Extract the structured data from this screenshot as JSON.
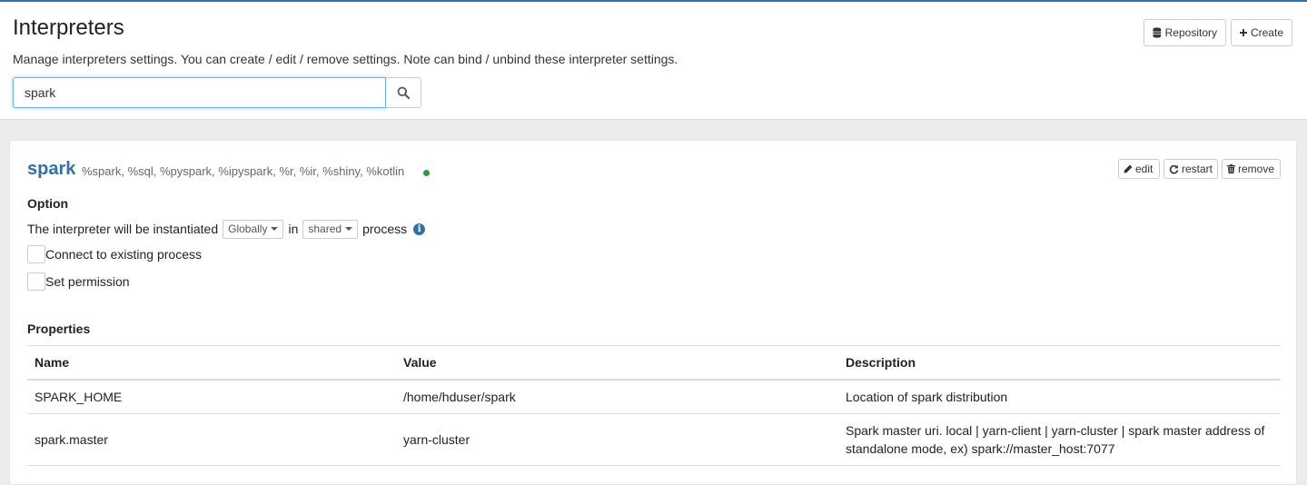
{
  "header": {
    "title": "Interpreters",
    "description": "Manage interpreters settings. You can create / edit / remove settings. Note can bind / unbind these interpreter settings.",
    "repository_label": "Repository",
    "create_label": "Create"
  },
  "search": {
    "value": "spark",
    "icon": "search-icon"
  },
  "interpreter": {
    "name": "spark",
    "aliases": "%spark, %sql, %pyspark, %ipyspark, %r, %ir, %shiny, %kotlin",
    "status_color": "#1f9e3a",
    "edit_label": "edit",
    "restart_label": "restart",
    "remove_label": "remove",
    "option": {
      "heading": "Option",
      "instantiated_text": "The interpreter will be instantiated",
      "scope_value": "Globally",
      "in_text": "in",
      "mode_value": "shared",
      "process_text": "process",
      "connect_label": "Connect to existing process",
      "connect_checked": false,
      "permission_label": "Set permission",
      "permission_checked": false
    },
    "properties": {
      "heading": "Properties",
      "columns": [
        "Name",
        "Value",
        "Description"
      ],
      "rows": [
        {
          "name": "SPARK_HOME",
          "value": "/home/hduser/spark",
          "description": "Location of spark distribution"
        },
        {
          "name": "spark.master",
          "value": "yarn-cluster",
          "description_line1": "Spark master uri. local | yarn-client | yarn-cluster | spark master address of",
          "description_line2": "standalone mode, ex) spark://master_host:7077"
        }
      ]
    }
  },
  "colors": {
    "accent": "#3071a9",
    "focus_border": "#66afe9"
  }
}
